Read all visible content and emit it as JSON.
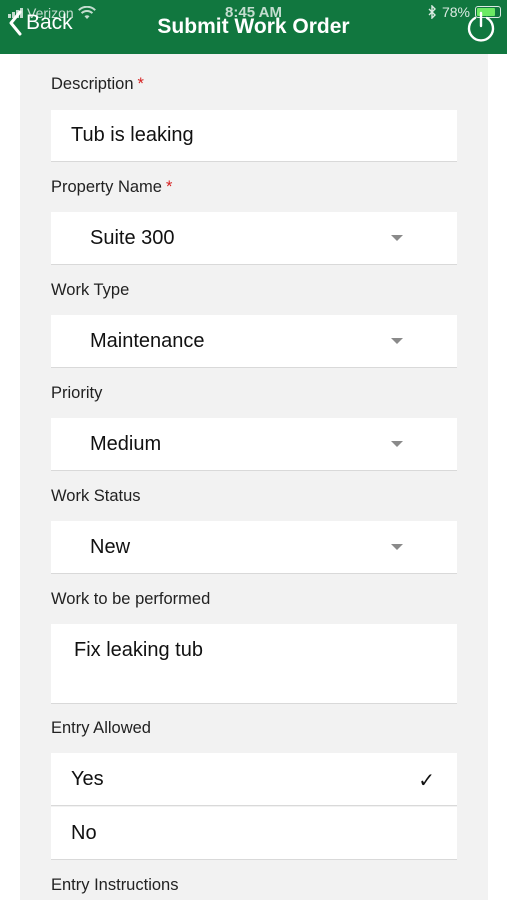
{
  "status_bar": {
    "carrier": "Verizon",
    "time": "8:45 AM",
    "battery": "78%"
  },
  "header": {
    "back_label": "Back",
    "title": "Submit Work Order"
  },
  "form": {
    "description": {
      "label": "Description",
      "required_mark": "*",
      "value": "Tub is leaking"
    },
    "property_name": {
      "label": "Property Name",
      "required_mark": "*",
      "value": "Suite 300"
    },
    "work_type": {
      "label": "Work Type",
      "value": "Maintenance"
    },
    "priority": {
      "label": "Priority",
      "value": "Medium"
    },
    "work_status": {
      "label": "Work Status",
      "value": "New"
    },
    "work_to_be_performed": {
      "label": "Work to be performed",
      "value": "Fix leaking tub"
    },
    "entry_allowed": {
      "label": "Entry Allowed",
      "options": [
        "Yes",
        "No"
      ],
      "selected": "Yes",
      "check_mark": "✓"
    },
    "entry_instructions": {
      "label": "Entry Instructions"
    }
  }
}
